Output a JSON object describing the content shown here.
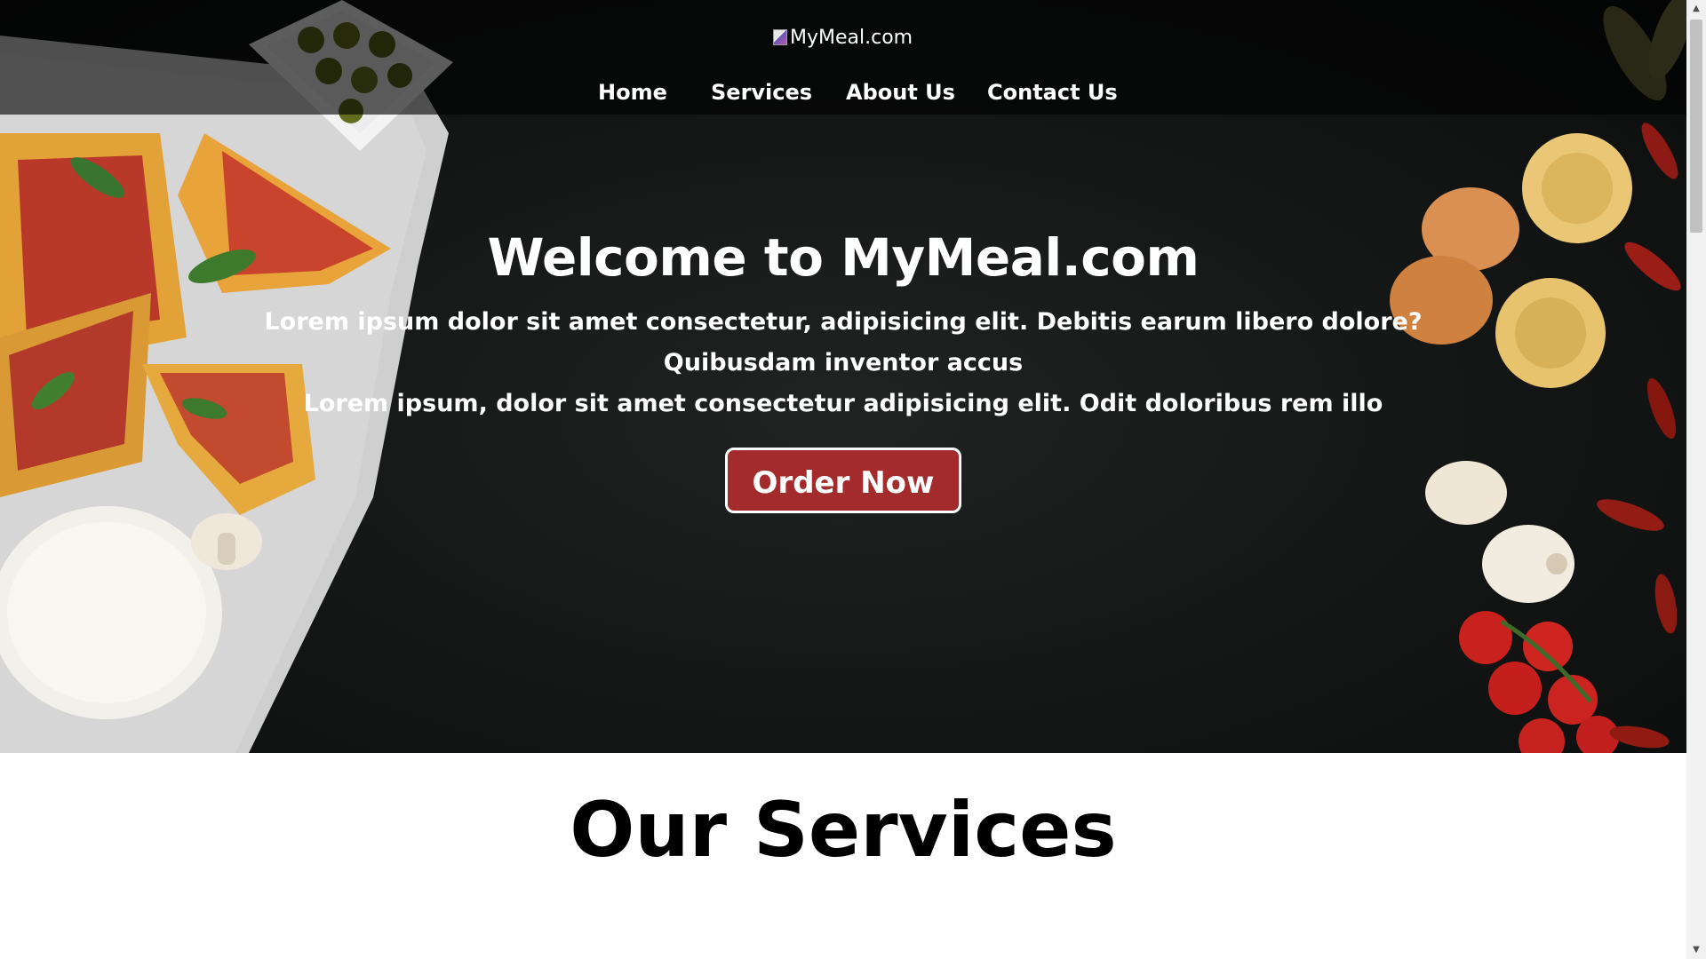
{
  "header": {
    "logo_alt": "MyMeal.com",
    "nav": [
      {
        "label": "Home"
      },
      {
        "label": "Services"
      },
      {
        "label": "About Us"
      },
      {
        "label": "Contact Us"
      }
    ]
  },
  "hero": {
    "title": "Welcome to MyMeal.com",
    "paragraph_1": "Lorem ipsum dolor sit amet consectetur, adipisicing elit. Debitis earum libero dolore? Quibusdam inventor accus",
    "paragraph_2": "Lorem ipsum, dolor sit amet consectetur adipisicing elit. Odit doloribus rem illo",
    "order_button": "Order Now"
  },
  "services": {
    "title": "Our Services"
  },
  "colors": {
    "accent_button": "#a32b2b",
    "hero_background": "#141616",
    "topbar_overlay": "rgba(0,0,0,0.62)"
  },
  "icons": {
    "scroll_up": "triangle-up-icon",
    "scroll_down": "triangle-down-icon",
    "broken_image": "broken-image-icon"
  }
}
